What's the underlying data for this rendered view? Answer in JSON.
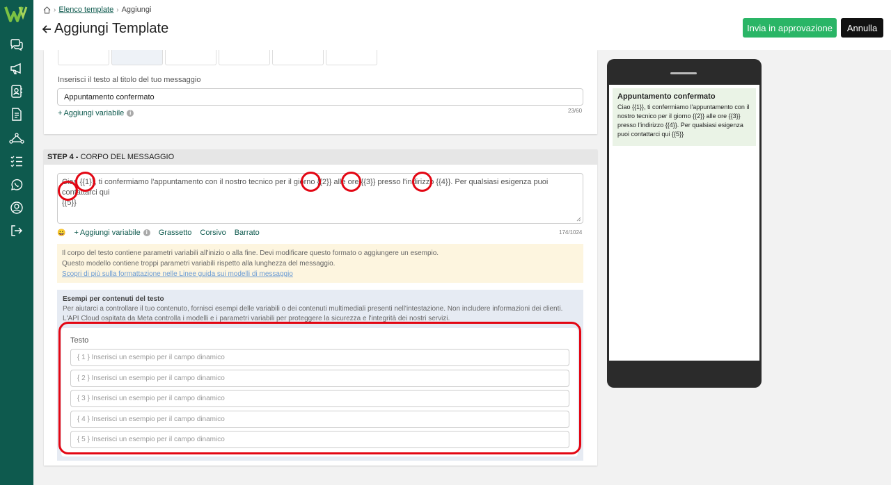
{
  "breadcrumb": {
    "home_icon": "home-icon",
    "parent": "Elenco template",
    "current": "Aggiungi"
  },
  "page": {
    "title": "Aggiungi Template",
    "back_icon": "arrow-left-icon"
  },
  "actions": {
    "approve_label": "Invia in approvazione",
    "cancel_label": "Annulla"
  },
  "sidebar": {
    "logo": "W",
    "items": [
      {
        "icon": "chat-icon"
      },
      {
        "icon": "megaphone-icon"
      },
      {
        "icon": "contacts-icon"
      },
      {
        "icon": "document-icon"
      },
      {
        "icon": "flow-icon"
      },
      {
        "icon": "checklist-icon"
      },
      {
        "icon": "whatsapp-icon"
      },
      {
        "icon": "user-circle-icon"
      },
      {
        "icon": "logout-icon"
      }
    ]
  },
  "step3": {
    "title_label": "Inserisci il testo al titolo del tuo messaggio",
    "title_value": "Appuntamento confermato",
    "add_variable": "Aggiungi variabile",
    "counter": "23/60"
  },
  "step4": {
    "header_bold": "STEP 4 -",
    "header_rest": " CORPO DEL MESSAGGIO",
    "body_line1": "Ciao {{1}}, ti confermiamo l'appuntamento con il nostro tecnico per il giorno {{2}} alle ore {{3}} presso l'indirizzo {{4}}. Per qualsiasi esigenza puoi contattarci qui",
    "body_line2": "{{5}}",
    "emoji": "😀",
    "add_variable": "Aggiungi variabile",
    "bold": "Grassetto",
    "italic": "Corsivo",
    "strike": "Barrato",
    "counter": "174/1024",
    "warning_line1": "Il corpo del testo contiene parametri variabili all'inizio o alla fine. Devi modificare questo formato o aggiungere un esempio.",
    "warning_line2": "Questo modello contiene troppi parametri variabili rispetto alla lunghezza del messaggio.",
    "warning_link": "Scopri di più sulla formattazione nelle Linee guida sui modelli di messaggio",
    "examples_title": "Esempi per contenuti del testo",
    "examples_desc": "Per aiutarci a controllare il tuo contenuto, fornisci esempi delle variabili o dei contenuti multimediali presenti nell'intestazione. Non includere informazioni dei clienti. L'API Cloud ospitata da Meta controlla i modelli e i parametri variabili per proteggere la sicurezza e l'integrità dei nostri servizi.",
    "testo_label": "Testo",
    "example_placeholders": [
      "{ 1 } Inserisci un esempio per il campo dinamico",
      "{ 2 } Inserisci un esempio per il campo dinamico",
      "{ 3 } Inserisci un esempio per il campo dinamico",
      "{ 4 } Inserisci un esempio per il campo dinamico",
      "{ 5 } Inserisci un esempio per il campo dinamico"
    ]
  },
  "preview": {
    "title": "Appuntamento confermato",
    "body": "Ciao {{1}}, ti confermiamo l'appuntamento con il nostro tecnico per il giorno {{2}} alle ore {{3}} presso l'indirizzo {{4}}. Per qualsiasi esigenza puoi contattarci qui {{5}}"
  },
  "colors": {
    "sidebar": "#0e5a4e",
    "approve": "#2ab566",
    "annotation": "#e30613"
  }
}
